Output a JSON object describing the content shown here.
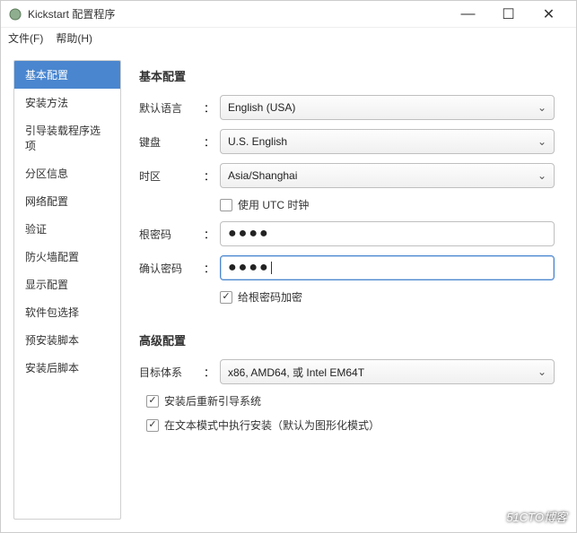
{
  "window": {
    "title": "Kickstart 配置程序",
    "controls": {
      "min": "—",
      "max": "☐",
      "close": "✕"
    }
  },
  "menu": {
    "file": "文件(F)",
    "help": "帮助(H)"
  },
  "sidebar": {
    "items": [
      {
        "label": "基本配置",
        "active": true
      },
      {
        "label": "安装方法"
      },
      {
        "label": "引导装载程序选项"
      },
      {
        "label": "分区信息"
      },
      {
        "label": "网络配置"
      },
      {
        "label": "验证"
      },
      {
        "label": "防火墙配置"
      },
      {
        "label": "显示配置"
      },
      {
        "label": "软件包选择"
      },
      {
        "label": "预安装脚本"
      },
      {
        "label": "安装后脚本"
      }
    ]
  },
  "basic": {
    "heading": "基本配置",
    "lang_label": "默认语言",
    "lang_value": "English (USA)",
    "keyboard_label": "键盘",
    "keyboard_value": "U.S. English",
    "tz_label": "时区",
    "tz_value": "Asia/Shanghai",
    "utc_label": "使用 UTC 时钟",
    "utc_checked": false,
    "rootpw_label": "根密码",
    "rootpw_value": "●●●●",
    "confirmpw_label": "确认密码",
    "confirmpw_value": "●●●●",
    "encrypt_label": "给根密码加密",
    "encrypt_checked": true,
    "colon": "："
  },
  "advanced": {
    "heading": "高级配置",
    "arch_label": "目标体系",
    "arch_value": "x86, AMD64, 或 Intel EM64T",
    "reboot_label": "安装后重新引导系统",
    "reboot_checked": true,
    "textmode_label": "在文本模式中执行安装（默认为图形化模式）",
    "textmode_checked": true
  },
  "watermark": "51CTO博客"
}
